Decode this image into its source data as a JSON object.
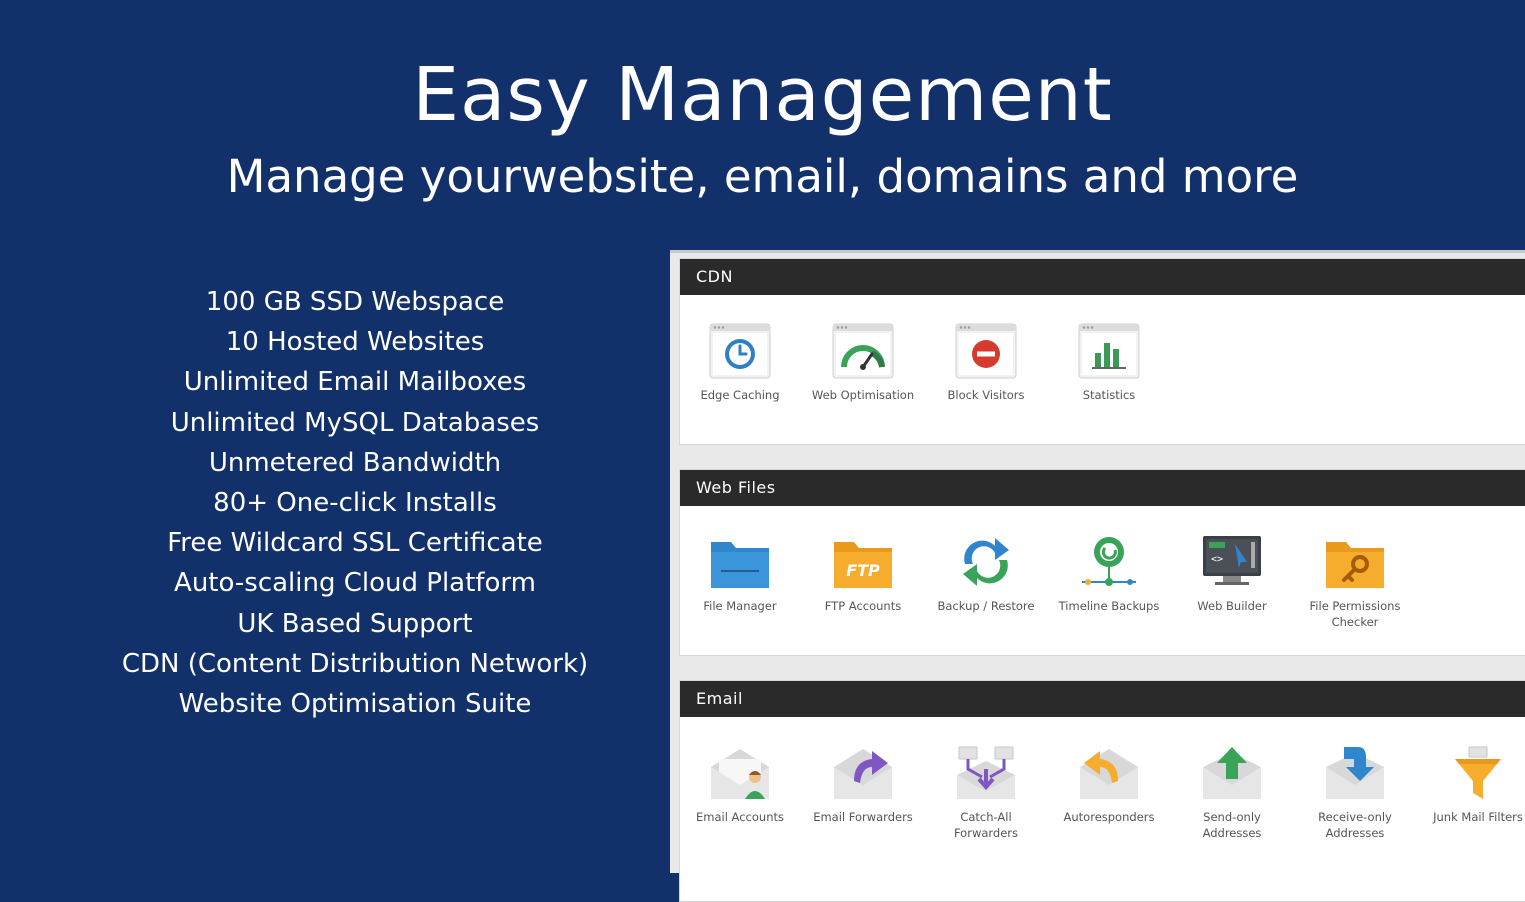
{
  "hero": {
    "title": "Easy Management",
    "subtitle": "Manage yourwebsite, email, domains and more"
  },
  "features": [
    "100 GB SSD Webspace",
    "10 Hosted Websites",
    "Unlimited Email Mailboxes",
    "Unlimited MySQL Databases",
    "Unmetered Bandwidth",
    "80+ One-click Installs",
    "Free Wildcard SSL Certificate",
    "Auto-scaling Cloud Platform",
    "UK Based Support",
    "CDN (Content Distribution Network)",
    "Website Optimisation Suite"
  ],
  "panel": {
    "sections": [
      {
        "title": "CDN",
        "items": [
          {
            "label": "Edge Caching",
            "icon": "clock-window-icon"
          },
          {
            "label": "Web Optimisation",
            "icon": "gauge-window-icon"
          },
          {
            "label": "Block Visitors",
            "icon": "block-window-icon"
          },
          {
            "label": "Statistics",
            "icon": "bar-chart-window-icon"
          }
        ]
      },
      {
        "title": "Web Files",
        "items": [
          {
            "label": "File Manager",
            "icon": "blue-folder-icon"
          },
          {
            "label": "FTP Accounts",
            "icon": "ftp-folder-icon"
          },
          {
            "label": "Backup / Restore",
            "icon": "backup-arrows-icon"
          },
          {
            "label": "Timeline Backups",
            "icon": "timeline-icon"
          },
          {
            "label": "Web Builder",
            "icon": "monitor-builder-icon"
          },
          {
            "label": "File Permissions Checker",
            "icon": "key-folder-icon"
          }
        ]
      },
      {
        "title": "Email",
        "items": [
          {
            "label": "Email Accounts",
            "icon": "envelope-user-icon"
          },
          {
            "label": "Email Forwarders",
            "icon": "envelope-forward-icon"
          },
          {
            "label": "Catch-All Forwarders",
            "icon": "catch-all-icon"
          },
          {
            "label": "Autoresponders",
            "icon": "envelope-reply-icon"
          },
          {
            "label": "Send-only Addresses",
            "icon": "envelope-up-icon"
          },
          {
            "label": "Receive-only Addresses",
            "icon": "envelope-down-icon"
          },
          {
            "label": "Junk Mail Filters",
            "icon": "funnel-icon"
          }
        ]
      }
    ]
  }
}
